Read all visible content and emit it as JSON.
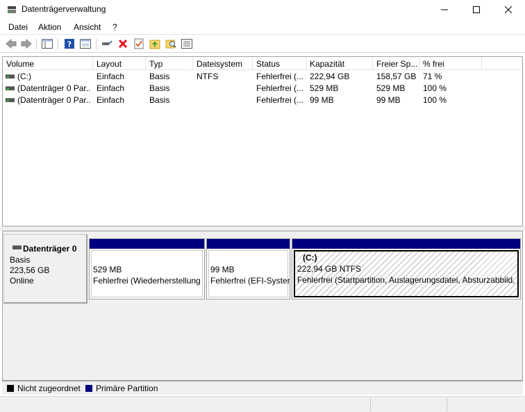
{
  "window": {
    "title": "Datenträgerverwaltung"
  },
  "menu": {
    "items": [
      "Datei",
      "Aktion",
      "Ansicht",
      "?"
    ]
  },
  "toolbar": {
    "icons": [
      "back-icon",
      "forward-icon",
      "show-hide-console-tree-icon",
      "help-icon",
      "properties-view-icon",
      "connect-disk-icon",
      "delete-icon",
      "check-properties-icon",
      "open-folder-icon",
      "explore-search-icon",
      "details-list-icon"
    ]
  },
  "volume_list": {
    "columns": [
      "Volume",
      "Layout",
      "Typ",
      "Dateisystem",
      "Status",
      "Kapazität",
      "Freier Sp...",
      "% frei"
    ],
    "rows": [
      {
        "volume": "(C:)",
        "layout": "Einfach",
        "typ": "Basis",
        "dateisystem": "NTFS",
        "status": "Fehlerfrei (...",
        "kapazitaet": "222,94 GB",
        "frei": "158,57 GB",
        "prozent": "71 %"
      },
      {
        "volume": "(Datenträger 0 Par...",
        "layout": "Einfach",
        "typ": "Basis",
        "dateisystem": "",
        "status": "Fehlerfrei (...",
        "kapazitaet": "529 MB",
        "frei": "529 MB",
        "prozent": "100 %"
      },
      {
        "volume": "(Datenträger 0 Par...",
        "layout": "Einfach",
        "typ": "Basis",
        "dateisystem": "",
        "status": "Fehlerfrei (...",
        "kapazitaet": "99 MB",
        "frei": "99 MB",
        "prozent": "100 %"
      }
    ]
  },
  "disk": {
    "name": "Datenträger 0",
    "type": "Basis",
    "size": "223,56 GB",
    "state": "Online",
    "partitions": [
      {
        "title": "",
        "size": "529 MB",
        "status": "Fehlerfrei (Wiederherstellung"
      },
      {
        "title": "",
        "size": "99 MB",
        "status": "Fehlerfrei (EFI-Systen"
      },
      {
        "title": "(C:)",
        "size": "222,94 GB NTFS",
        "status": "Fehlerfrei (Startpartition, Auslagerungsdatei, Absturzabbild,"
      }
    ]
  },
  "legend": [
    {
      "label": "Nicht zugeordnet",
      "color": "#000000"
    },
    {
      "label": "Primäre Partition",
      "color": "#000080"
    }
  ],
  "colors": {
    "partition_bar": "#000080",
    "unallocated": "#000000",
    "delete_icon": "#e81123"
  }
}
